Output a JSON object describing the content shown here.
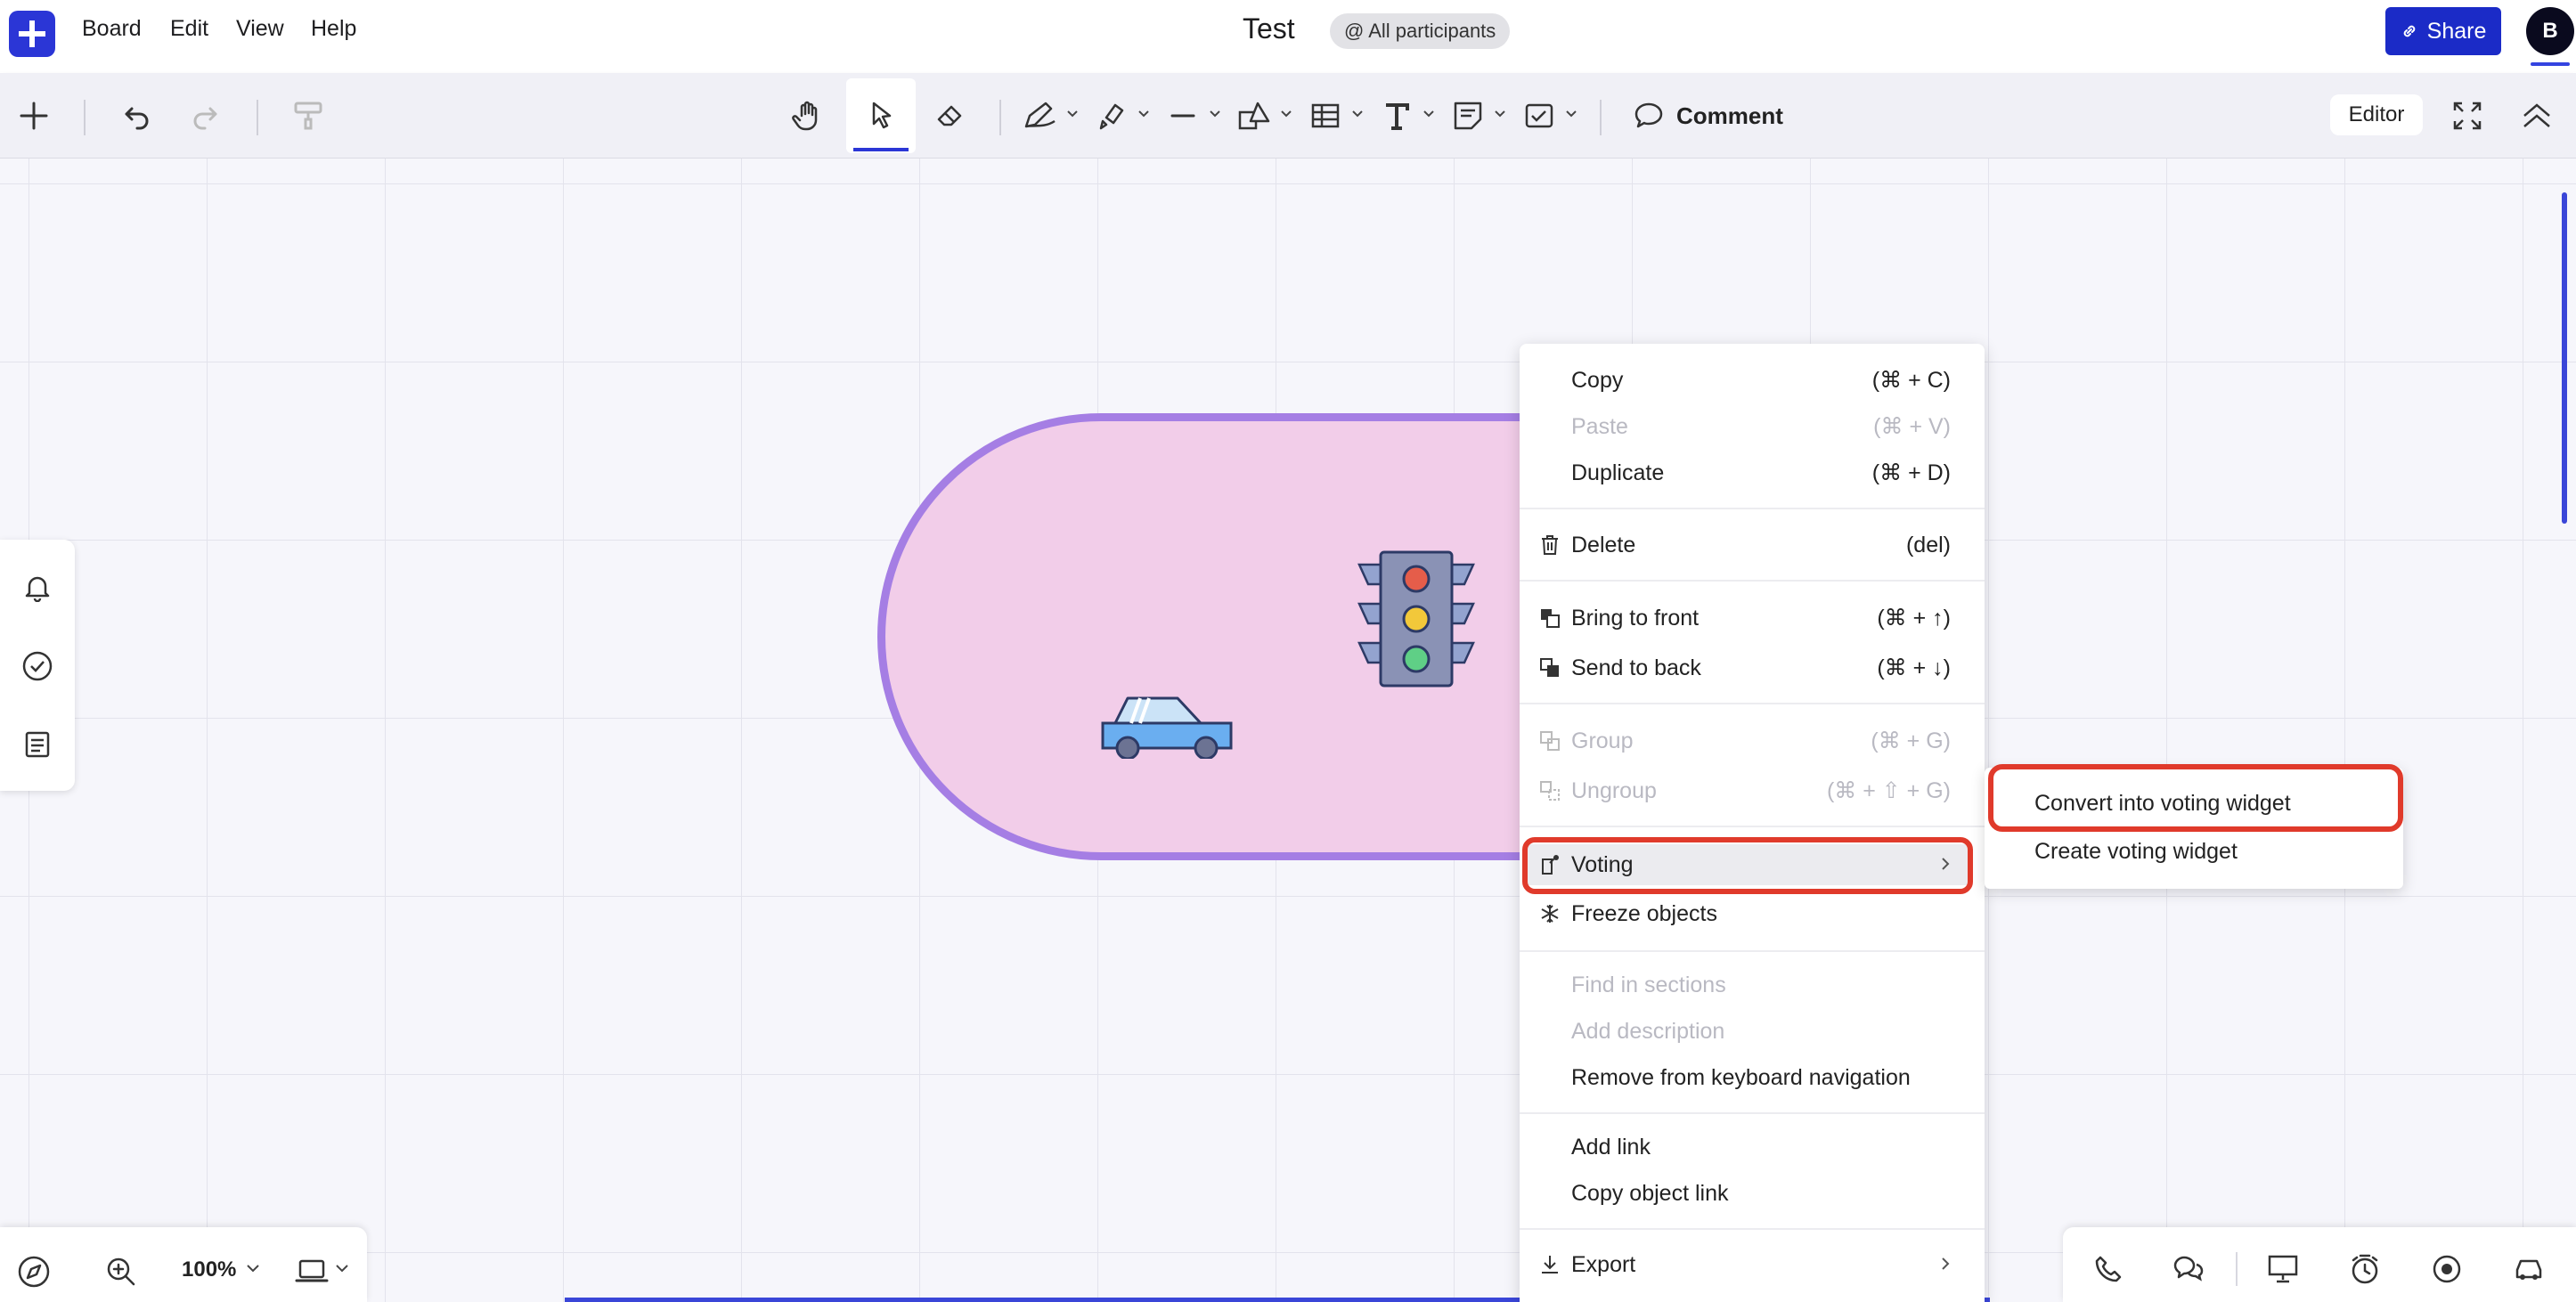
{
  "menubar": {
    "items": [
      "Board",
      "Edit",
      "View",
      "Help"
    ],
    "title": "Test",
    "participants": "@ All participants",
    "share_label": "Share",
    "avatar_initial": "B"
  },
  "toolbar": {
    "comment_label": "Comment",
    "editor_label": "Editor",
    "tools": [
      "add-icon",
      "undo-icon",
      "redo-icon",
      "format-painter-icon",
      "hand-icon",
      "select-cursor-icon",
      "eraser-icon",
      "pen-icon",
      "highlighter-icon",
      "line-icon",
      "shapes-icon",
      "table-icon",
      "text-icon",
      "sticky-note-icon",
      "checkbox-icon",
      "comment-icon",
      "fullscreen-icon",
      "collapse-icon"
    ]
  },
  "left_panel": {
    "icons": [
      "bell-icon",
      "check-circle-icon",
      "list-icon"
    ]
  },
  "bottom_left": {
    "zoom": "100%"
  },
  "bottom_right": {
    "icons": [
      "phone-icon",
      "chat-icon",
      "presentation-icon",
      "timer-icon",
      "record-icon",
      "car-icon"
    ]
  },
  "context_menu": {
    "copy": {
      "label": "Copy",
      "shortcut": "(⌘ + C)"
    },
    "paste": {
      "label": "Paste",
      "shortcut": "(⌘ + V)"
    },
    "duplicate": {
      "label": "Duplicate",
      "shortcut": "(⌘ + D)"
    },
    "delete": {
      "label": "Delete",
      "shortcut": "(del)"
    },
    "bring_front": {
      "label": "Bring to front",
      "shortcut": "(⌘ + ↑)"
    },
    "send_back": {
      "label": "Send to back",
      "shortcut": "(⌘ + ↓)"
    },
    "group": {
      "label": "Group",
      "shortcut": "(⌘ + G)"
    },
    "ungroup": {
      "label": "Ungroup",
      "shortcut": "(⌘ + ⇧ + G)"
    },
    "voting": {
      "label": "Voting"
    },
    "freeze": {
      "label": "Freeze objects"
    },
    "find_sections": {
      "label": "Find in sections"
    },
    "add_description": {
      "label": "Add description"
    },
    "remove_keyboard": {
      "label": "Remove from keyboard navigation"
    },
    "add_link": {
      "label": "Add link"
    },
    "copy_link": {
      "label": "Copy object link"
    },
    "export": {
      "label": "Export"
    }
  },
  "submenu": {
    "convert": "Convert into voting widget",
    "create": "Create voting widget"
  },
  "colors": {
    "brand": "#2b36d6",
    "share": "#1b2bc7",
    "highlight": "#e03a2b",
    "shape_fill": "#f2cde9",
    "shape_border": "#a57ee4"
  }
}
